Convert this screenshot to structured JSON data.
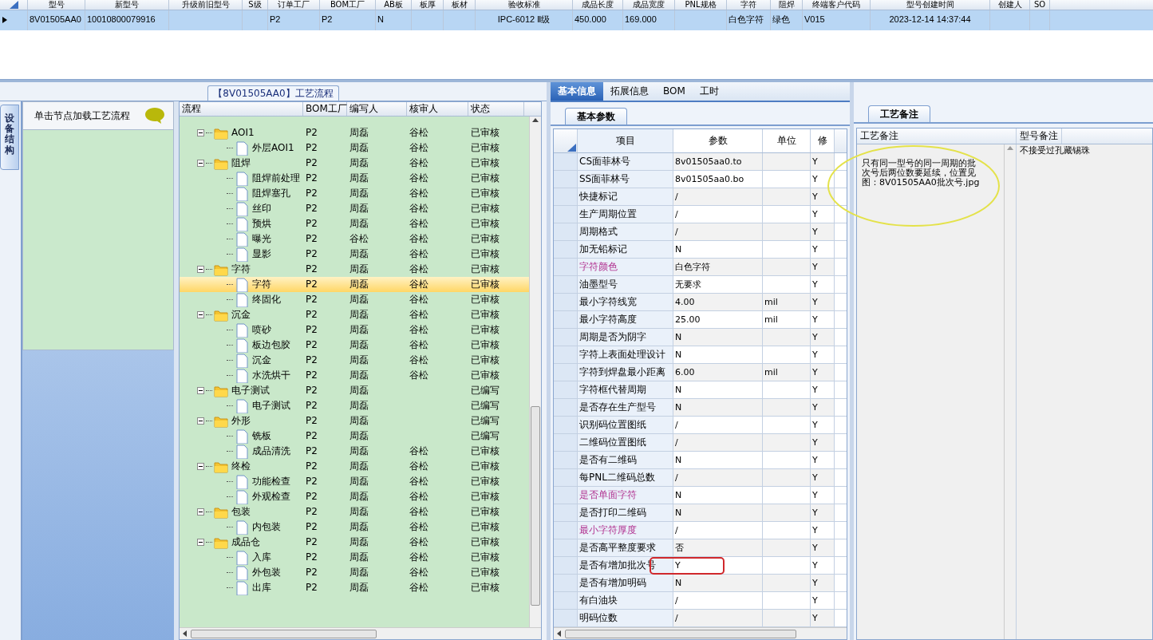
{
  "top_grid": {
    "columns": [
      "型号",
      "新型号",
      "升级前旧型号",
      "S级",
      "订单工厂",
      "BOM工厂",
      "AB板",
      "板厚",
      "板材",
      "验收标准",
      "成品长度",
      "成品宽度",
      "PNL规格",
      "字符",
      "阻焊",
      "终端客户代码",
      "型号创建时间",
      "创建人",
      "SO"
    ],
    "rows": [
      {
        "selected": true,
        "cells": [
          "8V01505AA0",
          "10010800079916",
          null,
          null,
          "P2",
          "P2",
          "N",
          null,
          null,
          "IPC-6012 Ⅱ级",
          "450.000",
          "169.000",
          null,
          "白色字符",
          "绿色",
          "V015",
          "2023-12-14 14:37:44",
          null,
          null
        ]
      }
    ]
  },
  "process_panel": {
    "title": "【8V01505AA0】工艺流程",
    "side_tab": "设备结构",
    "hint": "单击节点加载工艺流程"
  },
  "process_tree": {
    "columns": [
      "流程",
      "BOM工厂",
      "编写人",
      "核审人",
      "状态"
    ],
    "items": [
      {
        "kind": "folder",
        "expanded": true,
        "selected": false,
        "cells": [
          "AOI1",
          "P2",
          "周磊",
          "谷松",
          "已审核"
        ],
        "children": [
          {
            "kind": "step",
            "selected": false,
            "cells": [
              "外层AOI1",
              "P2",
              "周磊",
              "谷松",
              "已审核"
            ]
          }
        ]
      },
      {
        "kind": "folder",
        "expanded": true,
        "selected": false,
        "cells": [
          "阻焊",
          "P2",
          "周磊",
          "谷松",
          "已审核"
        ],
        "children": [
          {
            "kind": "step",
            "selected": false,
            "cells": [
              "阻焊前处理",
              "P2",
              "周磊",
              "谷松",
              "已审核"
            ]
          },
          {
            "kind": "step",
            "selected": false,
            "cells": [
              "阻焊塞孔",
              "P2",
              "周磊",
              "谷松",
              "已审核"
            ]
          },
          {
            "kind": "step",
            "selected": false,
            "cells": [
              "丝印",
              "P2",
              "周磊",
              "谷松",
              "已审核"
            ]
          },
          {
            "kind": "step",
            "selected": false,
            "cells": [
              "预烘",
              "P2",
              "周磊",
              "谷松",
              "已审核"
            ]
          },
          {
            "kind": "step",
            "selected": false,
            "cells": [
              "曝光",
              "P2",
              "谷松",
              "谷松",
              "已审核"
            ]
          },
          {
            "kind": "step",
            "selected": false,
            "cells": [
              "显影",
              "P2",
              "周磊",
              "谷松",
              "已审核"
            ]
          }
        ]
      },
      {
        "kind": "folder",
        "expanded": true,
        "selected": false,
        "cells": [
          "字符",
          "P2",
          "周磊",
          "谷松",
          "已审核"
        ],
        "children": [
          {
            "kind": "step",
            "selected": true,
            "cells": [
              "字符",
              "P2",
              "周磊",
              "谷松",
              "已审核"
            ]
          },
          {
            "kind": "step",
            "selected": false,
            "cells": [
              "终固化",
              "P2",
              "周磊",
              "谷松",
              "已审核"
            ]
          }
        ]
      },
      {
        "kind": "folder",
        "expanded": true,
        "selected": false,
        "cells": [
          "沉金",
          "P2",
          "周磊",
          "谷松",
          "已审核"
        ],
        "children": [
          {
            "kind": "step",
            "selected": false,
            "cells": [
              "喷砂",
              "P2",
              "周磊",
              "谷松",
              "已审核"
            ]
          },
          {
            "kind": "step",
            "selected": false,
            "cells": [
              "板边包胶",
              "P2",
              "周磊",
              "谷松",
              "已审核"
            ]
          },
          {
            "kind": "step",
            "selected": false,
            "cells": [
              "沉金",
              "P2",
              "周磊",
              "谷松",
              "已审核"
            ]
          },
          {
            "kind": "step",
            "selected": false,
            "cells": [
              "水洗烘干",
              "P2",
              "周磊",
              "谷松",
              "已审核"
            ]
          }
        ]
      },
      {
        "kind": "folder",
        "expanded": true,
        "selected": false,
        "cells": [
          "电子测试",
          "P2",
          "周磊",
          null,
          "已编写"
        ],
        "children": [
          {
            "kind": "step",
            "selected": false,
            "cells": [
              "电子测试",
              "P2",
              "周磊",
              null,
              "已编写"
            ]
          }
        ]
      },
      {
        "kind": "folder",
        "expanded": true,
        "selected": false,
        "cells": [
          "外形",
          "P2",
          "周磊",
          null,
          "已编写"
        ],
        "children": [
          {
            "kind": "step",
            "selected": false,
            "cells": [
              "铣板",
              "P2",
              "周磊",
              null,
              "已编写"
            ]
          },
          {
            "kind": "step",
            "selected": false,
            "cells": [
              "成品清洗",
              "P2",
              "周磊",
              "谷松",
              "已审核"
            ]
          }
        ]
      },
      {
        "kind": "folder",
        "expanded": true,
        "selected": false,
        "cells": [
          "终检",
          "P2",
          "周磊",
          "谷松",
          "已审核"
        ],
        "children": [
          {
            "kind": "step",
            "selected": false,
            "cells": [
              "功能检查",
              "P2",
              "周磊",
              "谷松",
              "已审核"
            ]
          },
          {
            "kind": "step",
            "selected": false,
            "cells": [
              "外观检查",
              "P2",
              "周磊",
              "谷松",
              "已审核"
            ]
          }
        ]
      },
      {
        "kind": "folder",
        "expanded": true,
        "selected": false,
        "cells": [
          "包装",
          "P2",
          "周磊",
          "谷松",
          "已审核"
        ],
        "children": [
          {
            "kind": "step",
            "selected": false,
            "cells": [
              "内包装",
              "P2",
              "周磊",
              "谷松",
              "已审核"
            ]
          }
        ]
      },
      {
        "kind": "folder",
        "expanded": true,
        "selected": false,
        "cells": [
          "成品仓",
          "P2",
          "周磊",
          "谷松",
          "已审核"
        ],
        "children": [
          {
            "kind": "step",
            "selected": false,
            "cells": [
              "入库",
              "P2",
              "周磊",
              "谷松",
              "已审核"
            ]
          },
          {
            "kind": "step",
            "selected": false,
            "cells": [
              "外包装",
              "P2",
              "周磊",
              "谷松",
              "已审核"
            ]
          },
          {
            "kind": "step",
            "selected": false,
            "cells": [
              "出库",
              "P2",
              "周磊",
              "谷松",
              "已审核"
            ]
          }
        ]
      }
    ]
  },
  "detail_tabs": [
    {
      "label": "基本信息",
      "selected": true
    },
    {
      "label": "拓展信息",
      "selected": false
    },
    {
      "label": "BOM",
      "selected": false
    },
    {
      "label": "工时",
      "selected": false
    }
  ],
  "sub_tab": "基本参数",
  "params": {
    "columns": [
      "项目",
      "参数",
      "单位",
      "修"
    ],
    "rows": [
      {
        "item": "CS面菲林号",
        "value": "8v01505aa0.to",
        "unit": null,
        "mod": "Y",
        "emphasized": false,
        "circled": false
      },
      {
        "item": "SS面菲林号",
        "value": "8v01505aa0.bo",
        "unit": null,
        "mod": "Y",
        "emphasized": false,
        "circled": false
      },
      {
        "item": "快捷标记",
        "value": "/",
        "unit": null,
        "mod": "Y",
        "emphasized": false,
        "circled": false
      },
      {
        "item": "生产周期位置",
        "value": "/",
        "unit": null,
        "mod": "Y",
        "emphasized": false,
        "circled": false
      },
      {
        "item": "周期格式",
        "value": "/",
        "unit": null,
        "mod": "Y",
        "emphasized": false,
        "circled": false
      },
      {
        "item": "加无铅标记",
        "value": "N",
        "unit": null,
        "mod": "Y",
        "emphasized": false,
        "circled": false
      },
      {
        "item": "字符颜色",
        "value": "白色字符",
        "unit": null,
        "mod": "Y",
        "emphasized": true,
        "circled": false
      },
      {
        "item": "油墨型号",
        "value": "无要求",
        "unit": null,
        "mod": "Y",
        "emphasized": false,
        "circled": false
      },
      {
        "item": "最小字符线宽",
        "value": "4.00",
        "unit": "mil",
        "mod": "Y",
        "emphasized": false,
        "circled": false
      },
      {
        "item": "最小字符高度",
        "value": "25.00",
        "unit": "mil",
        "mod": "Y",
        "emphasized": false,
        "circled": false
      },
      {
        "item": "周期是否为阴字",
        "value": "N",
        "unit": null,
        "mod": "Y",
        "emphasized": false,
        "circled": false
      },
      {
        "item": "字符上表面处理设计",
        "value": "N",
        "unit": null,
        "mod": "Y",
        "emphasized": false,
        "circled": false
      },
      {
        "item": "字符到焊盘最小距离",
        "value": "6.00",
        "unit": "mil",
        "mod": "Y",
        "emphasized": false,
        "circled": false
      },
      {
        "item": "字符框代替周期",
        "value": "N",
        "unit": null,
        "mod": "Y",
        "emphasized": false,
        "circled": false
      },
      {
        "item": "是否存在生产型号",
        "value": "N",
        "unit": null,
        "mod": "Y",
        "emphasized": false,
        "circled": false
      },
      {
        "item": "识别码位置图纸",
        "value": "/",
        "unit": null,
        "mod": "Y",
        "emphasized": false,
        "circled": false
      },
      {
        "item": "二维码位置图纸",
        "value": "/",
        "unit": null,
        "mod": "Y",
        "emphasized": false,
        "circled": false
      },
      {
        "item": "是否有二维码",
        "value": "N",
        "unit": null,
        "mod": "Y",
        "emphasized": false,
        "circled": false
      },
      {
        "item": "每PNL二维码总数",
        "value": "/",
        "unit": null,
        "mod": "Y",
        "emphasized": false,
        "circled": false
      },
      {
        "item": "是否单面字符",
        "value": "N",
        "unit": null,
        "mod": "Y",
        "emphasized": true,
        "circled": false
      },
      {
        "item": "是否打印二维码",
        "value": "N",
        "unit": null,
        "mod": "Y",
        "emphasized": false,
        "circled": false
      },
      {
        "item": "最小字符厚度",
        "value": "/",
        "unit": null,
        "mod": "Y",
        "emphasized": true,
        "circled": false
      },
      {
        "item": "是否高平整度要求",
        "value": "否",
        "unit": null,
        "mod": "Y",
        "emphasized": false,
        "circled": false
      },
      {
        "item": "是否有增加批次号",
        "value": "Y",
        "unit": null,
        "mod": "Y",
        "emphasized": false,
        "circled": true
      },
      {
        "item": "是否有增加明码",
        "value": "N",
        "unit": null,
        "mod": "Y",
        "emphasized": false,
        "circled": false
      },
      {
        "item": "有白油块",
        "value": "/",
        "unit": null,
        "mod": "Y",
        "emphasized": false,
        "circled": false
      },
      {
        "item": "明码位数",
        "value": "/",
        "unit": null,
        "mod": "Y",
        "emphasized": false,
        "circled": false
      }
    ]
  },
  "remarks": {
    "tab": "工艺备注",
    "columns": [
      "工艺备注",
      "型号备注"
    ],
    "process_note": "只有同一型号的同一周期的批次号后两位数要延续，位置见图：8V01505AA0批次号.jpg",
    "model_note": "不接受过孔藏锡珠",
    "circled": true
  }
}
